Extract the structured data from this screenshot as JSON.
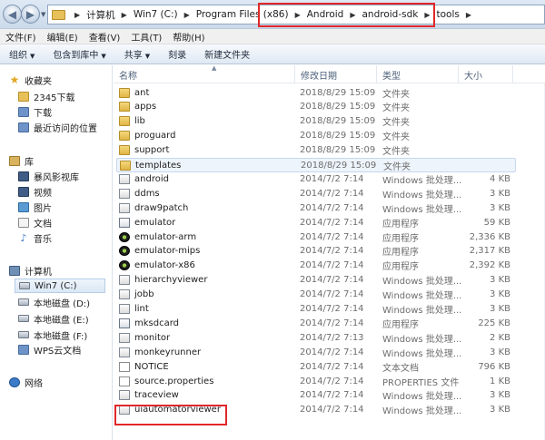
{
  "address": {
    "crumbs": [
      "计算机",
      "Win7 (C:)",
      "Program Files (x86)",
      "Android",
      "android-sdk",
      "tools"
    ]
  },
  "menu": [
    "文件(F)",
    "编辑(E)",
    "查看(V)",
    "工具(T)",
    "帮助(H)"
  ],
  "toolbar": {
    "organize": "组织",
    "include": "包含到库中",
    "share": "共享",
    "burn": "刻录",
    "new_folder": "新建文件夹"
  },
  "sidebar": {
    "favorites": "收藏夹",
    "fav_items": [
      "2345下载",
      "下载",
      "最近访问的位置"
    ],
    "libraries": "库",
    "lib_items": [
      "暴风影视库",
      "视频",
      "图片",
      "文档",
      "音乐"
    ],
    "computer": "计算机",
    "drives": [
      "Win7 (C:)",
      "本地磁盘 (D:)",
      "本地磁盘 (E:)",
      "本地磁盘 (F:)",
      "WPS云文档"
    ],
    "network": "网络"
  },
  "columns": {
    "name": "名称",
    "date": "修改日期",
    "type": "类型",
    "size": "大小"
  },
  "files": [
    {
      "name": "ant",
      "date": "2018/8/29 15:09",
      "type": "文件夹",
      "size": "",
      "icon": "folder"
    },
    {
      "name": "apps",
      "date": "2018/8/29 15:09",
      "type": "文件夹",
      "size": "",
      "icon": "folder"
    },
    {
      "name": "lib",
      "date": "2018/8/29 15:09",
      "type": "文件夹",
      "size": "",
      "icon": "folder"
    },
    {
      "name": "proguard",
      "date": "2018/8/29 15:09",
      "type": "文件夹",
      "size": "",
      "icon": "folder"
    },
    {
      "name": "support",
      "date": "2018/8/29 15:09",
      "type": "文件夹",
      "size": "",
      "icon": "folder"
    },
    {
      "name": "templates",
      "date": "2018/8/29 15:09",
      "type": "文件夹",
      "size": "",
      "icon": "folder"
    },
    {
      "name": "android",
      "date": "2014/7/2 7:14",
      "type": "Windows 批处理...",
      "size": "4 KB",
      "icon": "bat"
    },
    {
      "name": "ddms",
      "date": "2014/7/2 7:14",
      "type": "Windows 批处理...",
      "size": "3 KB",
      "icon": "bat"
    },
    {
      "name": "draw9patch",
      "date": "2014/7/2 7:14",
      "type": "Windows 批处理...",
      "size": "3 KB",
      "icon": "bat"
    },
    {
      "name": "emulator",
      "date": "2014/7/2 7:14",
      "type": "应用程序",
      "size": "59 KB",
      "icon": "exe"
    },
    {
      "name": "emulator-arm",
      "date": "2014/7/2 7:14",
      "type": "应用程序",
      "size": "2,336 KB",
      "icon": "emu"
    },
    {
      "name": "emulator-mips",
      "date": "2014/7/2 7:14",
      "type": "应用程序",
      "size": "2,317 KB",
      "icon": "emu"
    },
    {
      "name": "emulator-x86",
      "date": "2014/7/2 7:14",
      "type": "应用程序",
      "size": "2,392 KB",
      "icon": "emu"
    },
    {
      "name": "hierarchyviewer",
      "date": "2014/7/2 7:14",
      "type": "Windows 批处理...",
      "size": "3 KB",
      "icon": "bat"
    },
    {
      "name": "jobb",
      "date": "2014/7/2 7:14",
      "type": "Windows 批处理...",
      "size": "3 KB",
      "icon": "bat"
    },
    {
      "name": "lint",
      "date": "2014/7/2 7:14",
      "type": "Windows 批处理...",
      "size": "3 KB",
      "icon": "bat"
    },
    {
      "name": "mksdcard",
      "date": "2014/7/2 7:14",
      "type": "应用程序",
      "size": "225 KB",
      "icon": "exe"
    },
    {
      "name": "monitor",
      "date": "2014/7/2 7:13",
      "type": "Windows 批处理...",
      "size": "2 KB",
      "icon": "bat"
    },
    {
      "name": "monkeyrunner",
      "date": "2014/7/2 7:14",
      "type": "Windows 批处理...",
      "size": "3 KB",
      "icon": "bat"
    },
    {
      "name": "NOTICE",
      "date": "2014/7/2 7:14",
      "type": "文本文档",
      "size": "796 KB",
      "icon": "file"
    },
    {
      "name": "source.properties",
      "date": "2014/7/2 7:14",
      "type": "PROPERTIES 文件",
      "size": "1 KB",
      "icon": "file"
    },
    {
      "name": "traceview",
      "date": "2014/7/2 7:14",
      "type": "Windows 批处理...",
      "size": "3 KB",
      "icon": "bat"
    },
    {
      "name": "uiautomatorviewer",
      "date": "2014/7/2 7:14",
      "type": "Windows 批处理...",
      "size": "3 KB",
      "icon": "bat"
    }
  ],
  "highlight_color": "#e0282a"
}
